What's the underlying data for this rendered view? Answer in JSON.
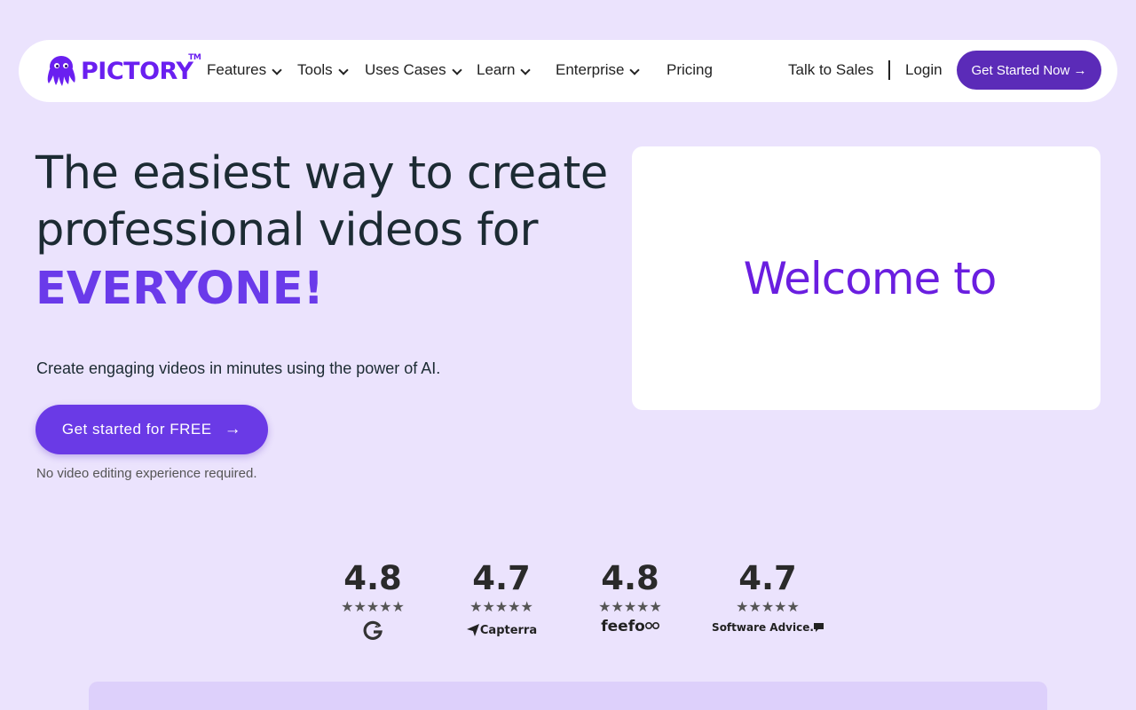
{
  "nav": {
    "logo_text": "PICTORY",
    "logo_tm": "TM",
    "items": [
      {
        "label": "Features",
        "dropdown": true
      },
      {
        "label": "Tools",
        "dropdown": true
      },
      {
        "label": "Uses Cases",
        "dropdown": true
      },
      {
        "label": "Learn",
        "dropdown": true
      },
      {
        "label": "Enterprise",
        "dropdown": true
      },
      {
        "label": "Pricing",
        "dropdown": false
      }
    ],
    "talk_to_sales": "Talk to Sales",
    "login": "Login",
    "cta": "Get Started Now →"
  },
  "hero": {
    "title_line1": "The easiest way to create",
    "title_line2": "professional videos for",
    "title_accent": "EVERYONE!",
    "subtitle": "Create engaging videos in minutes using the power of AI.",
    "cta": "Get started for FREE",
    "note": "No video editing experience required."
  },
  "video": {
    "text": "Welcome to"
  },
  "ratings": [
    {
      "score": "4.8",
      "stars": "★★★★★",
      "brand": "G2"
    },
    {
      "score": "4.7",
      "stars": "★★★★★",
      "brand": "Capterra"
    },
    {
      "score": "4.8",
      "stars": "★★★★★",
      "brand": "feefo"
    },
    {
      "score": "4.7",
      "stars": "★★★★★",
      "brand": "Software Advice."
    }
  ],
  "colors": {
    "background": "#ebe3fd",
    "brand": "#6a1ff0",
    "cta_nav": "#5b2bb8",
    "cta_hero": "#6a3ae6"
  }
}
